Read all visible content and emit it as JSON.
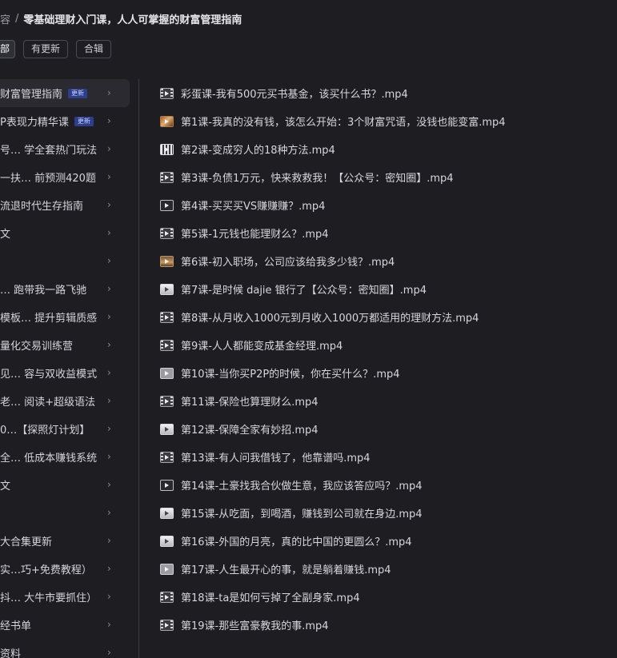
{
  "breadcrumb": {
    "prev": "容",
    "separator": "/",
    "current": "零基础理财入门课，人人可掌握的财富管理指南"
  },
  "filters": [
    {
      "label": "部",
      "active": true
    },
    {
      "label": "有更新",
      "active": false
    },
    {
      "label": "合辑",
      "active": false
    }
  ],
  "sidebar": {
    "chevron": "›",
    "items": [
      {
        "label": "财富管理指南",
        "badge": "更新",
        "active": true
      },
      {
        "label": "P表现力精华课",
        "badge": "更新"
      },
      {
        "label": "号… 学全套热门玩法"
      },
      {
        "label": "一扶… 前预测420题"
      },
      {
        "label": "流退时代生存指南"
      },
      {
        "label": "文"
      },
      {
        "label": ""
      },
      {
        "label": "… 跑带我一路飞驰"
      },
      {
        "label": "模板… 提升剪辑质感"
      },
      {
        "label": "量化交易训练营"
      },
      {
        "label": "见… 容与双收益模式"
      },
      {
        "label": "老… 阅读+超级语法"
      },
      {
        "label": "0…【探照灯计划】"
      },
      {
        "label": "全… 低成本赚钱系统"
      },
      {
        "label": "文"
      },
      {
        "label": ""
      },
      {
        "label": "大合集更新"
      },
      {
        "label": "实…巧+免费教程）"
      },
      {
        "label": "抖… 大牛市要抓住）"
      },
      {
        "label": "经书单"
      },
      {
        "label": "资料"
      }
    ]
  },
  "files": [
    {
      "name": "彩蛋课-我有500元买书基金，该买什么书？.mp4",
      "thumb": "film"
    },
    {
      "name": "第1课-我真的没有钱，该怎么开始：3个财富咒语，没钱也能变富.mp4",
      "thumb": "warm"
    },
    {
      "name": "第2课-变成穷人的18种方法.mp4",
      "thumb": "stripe"
    },
    {
      "name": "第3课-负债1万元，快来救救我！【公众号：密知圈】.mp4",
      "thumb": "film"
    },
    {
      "name": "第4课-买买买VS赚赚赚？.mp4",
      "thumb": "dark"
    },
    {
      "name": "第5课-1元钱也能理财么？.mp4",
      "thumb": "film"
    },
    {
      "name": "第6课-初入职场，公司应该给我多少钱？.mp4",
      "thumb": "room"
    },
    {
      "name": "第7课-是时候 dajie 银行了【公众号：密知圈】.mp4",
      "thumb": "sketch"
    },
    {
      "name": "第8课-从月收入1000元到月收入1000万都适用的理财方法.mp4",
      "thumb": "film"
    },
    {
      "name": "第9课-人人都能变成基金经理.mp4",
      "thumb": "film"
    },
    {
      "name": "第10课-当你买P2P的时候，你在买什么？.mp4",
      "thumb": "gray"
    },
    {
      "name": "第11课-保险也算理财么.mp4",
      "thumb": "film"
    },
    {
      "name": "第12课-保障全家有妙招.mp4",
      "thumb": "sketch"
    },
    {
      "name": "第13课-有人问我借钱了，他靠谱吗.mp4",
      "thumb": "film"
    },
    {
      "name": "第14课-土豪找我合伙做生意，我应该答应吗？.mp4",
      "thumb": "dark"
    },
    {
      "name": "第15课-从吃面，到喝酒，赚钱到公司就在身边.mp4",
      "thumb": "sketch"
    },
    {
      "name": "第16课-外国的月亮，真的比中国的更圆么？.mp4",
      "thumb": "sketch"
    },
    {
      "name": "第17课-人生最开心的事，就是躺着赚钱.mp4",
      "thumb": "gray"
    },
    {
      "name": "第18课-ta是如何亏掉了全副身家.mp4",
      "thumb": "film"
    },
    {
      "name": "第19课-那些富豪教我的事.mp4",
      "thumb": "film"
    }
  ]
}
